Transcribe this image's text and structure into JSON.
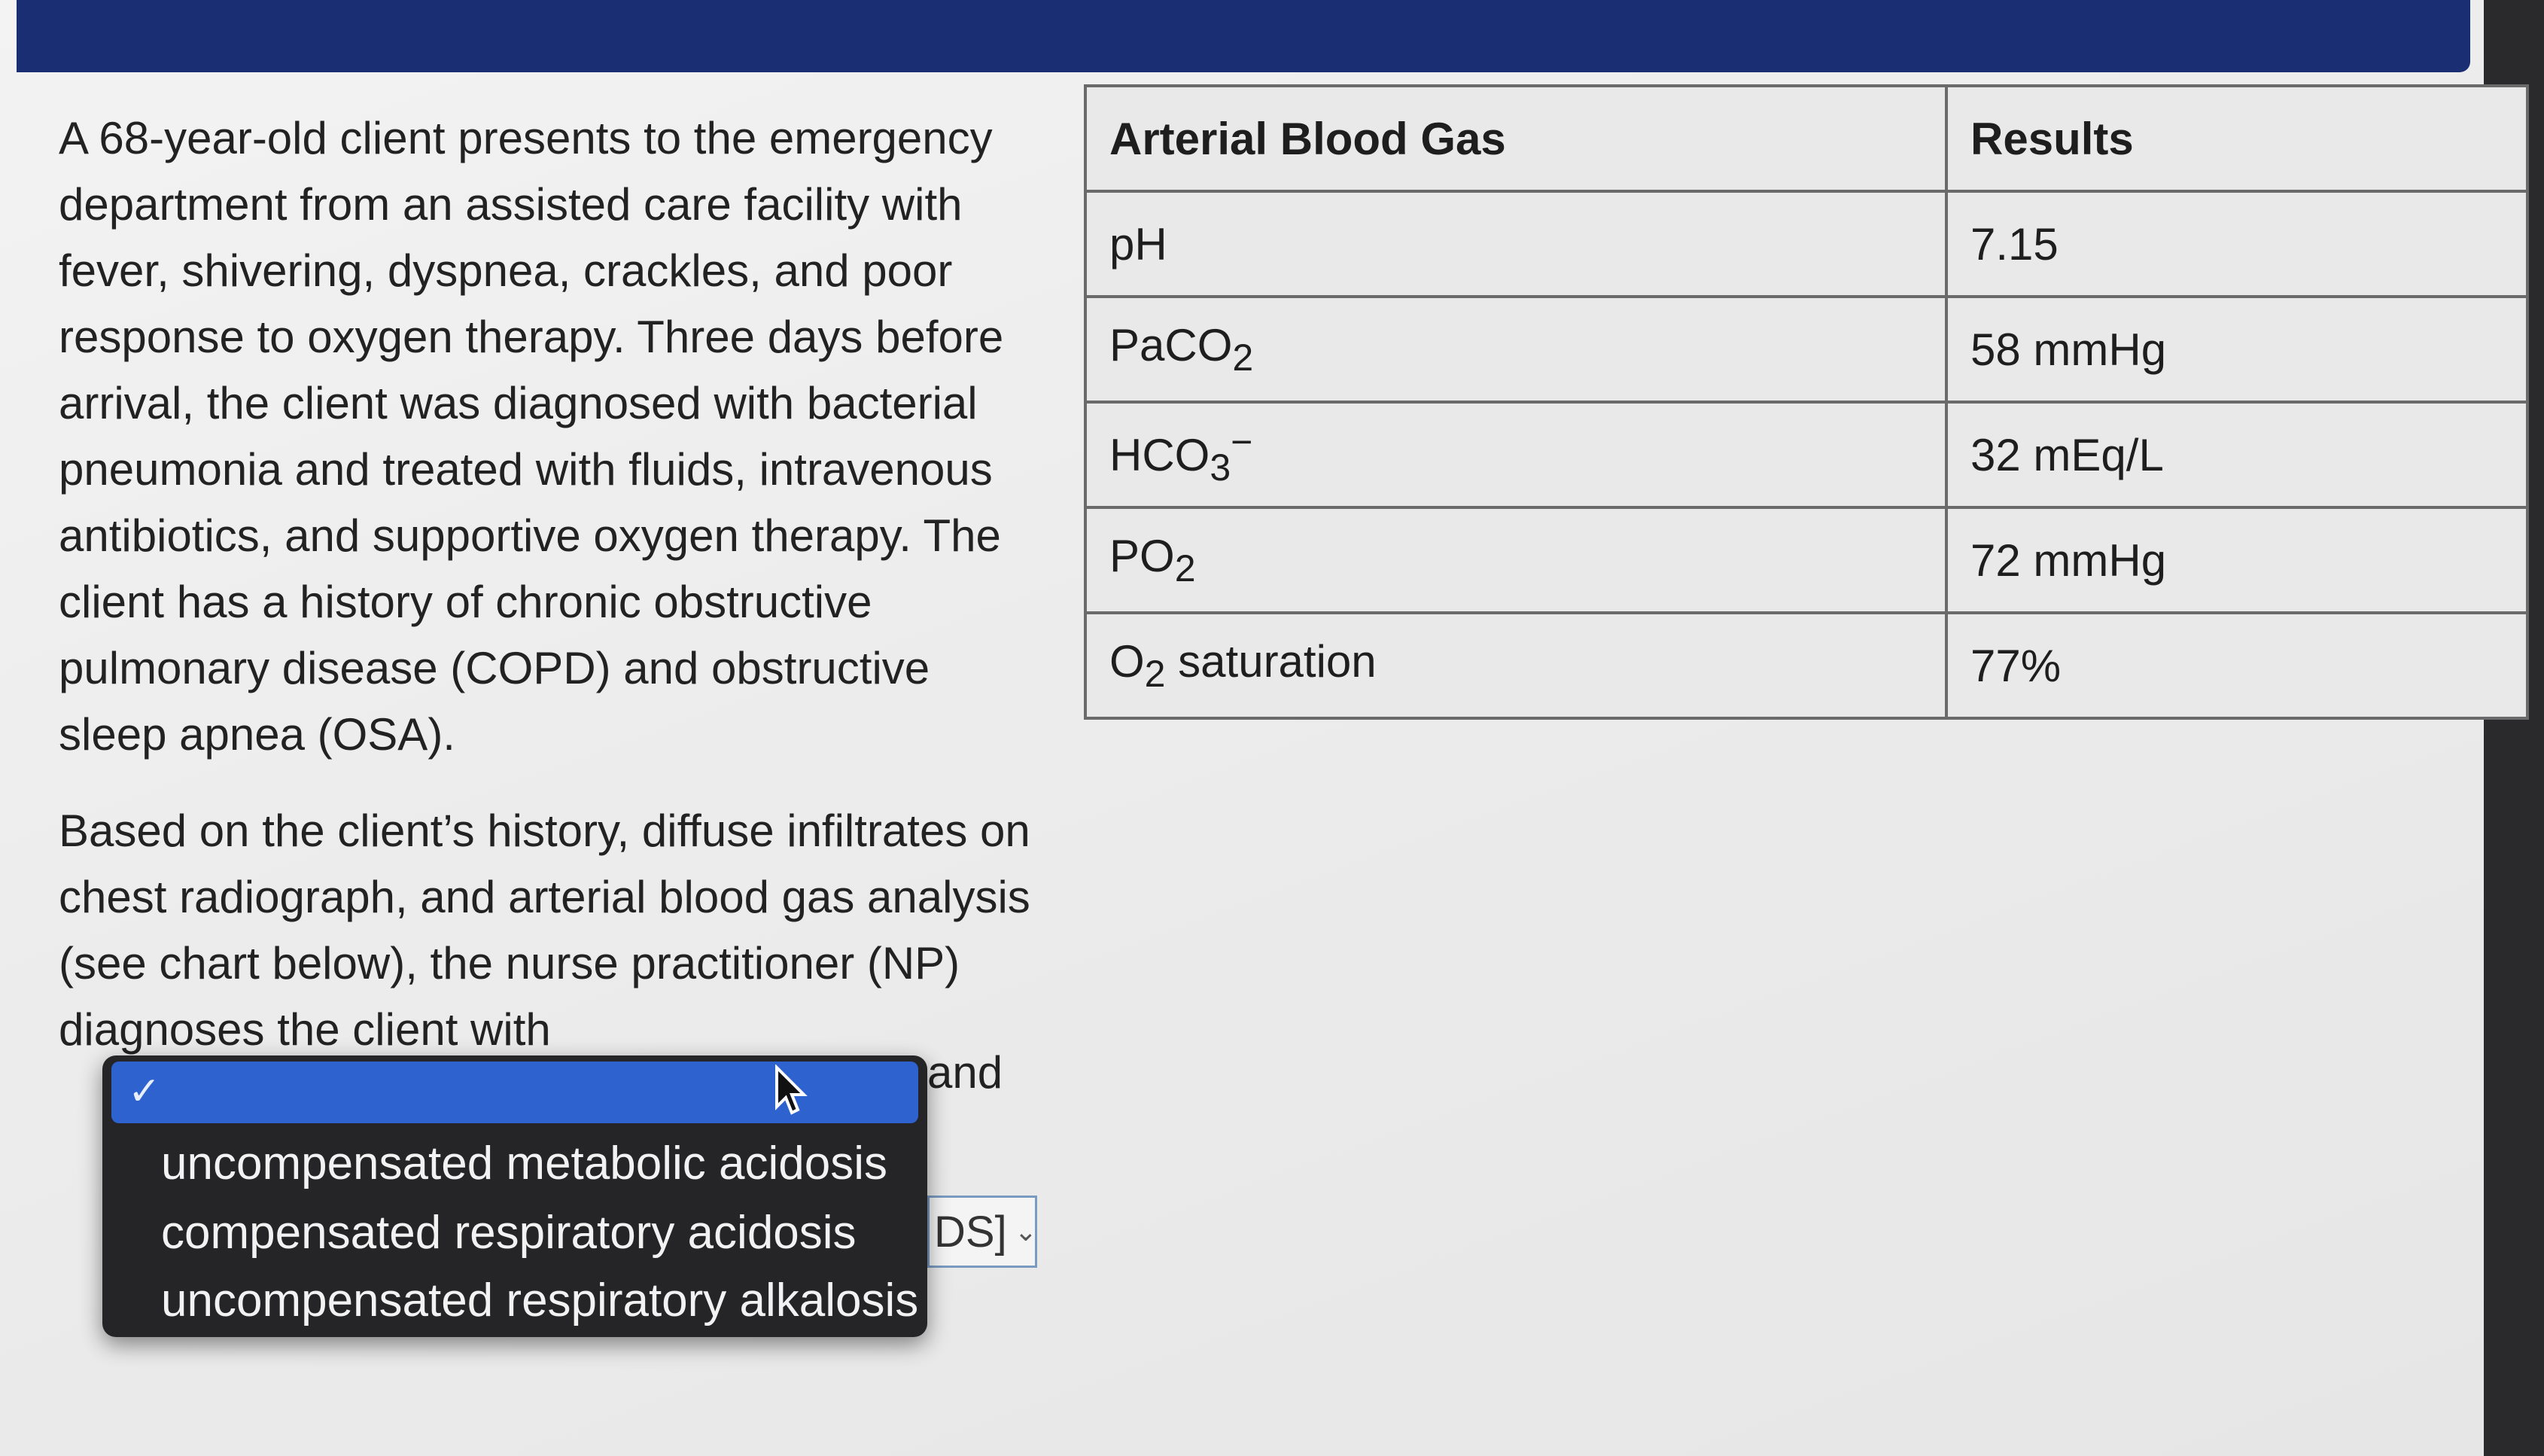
{
  "question": {
    "paragraph1": "A 68-year-old client presents to the emergency department from an assisted care facility with fever, shivering, dyspnea, crackles, and poor response to oxygen therapy. Three days before arrival, the client was diagnosed with bacterial pneumonia and treated with fluids, intravenous antibiotics, and supportive oxygen therapy. The client has a history of chronic obstructive pulmonary disease (COPD) and obstructive sleep apnea (OSA).",
    "paragraph2": "Based on the client’s history, diffuse infiltrates on chest radiograph, and arterial blood gas analysis (see chart below), the nurse practitioner (NP) diagnoses the client with",
    "connector": "and",
    "second_select_visible_text": "DS]"
  },
  "abg_table": {
    "header_test": "Arterial Blood Gas",
    "header_result": "Results",
    "rows": [
      {
        "test": "pH",
        "result": "7.15"
      },
      {
        "test": "PaCO",
        "test_sub": "2",
        "result": "58 mmHg"
      },
      {
        "test": "HCO",
        "test_sub": "3",
        "test_sup": "−",
        "result": "32 mEq/L"
      },
      {
        "test": "PO",
        "test_sub": "2",
        "result": "72 mmHg"
      },
      {
        "test": "O",
        "test_sub": "2",
        "test_suffix": " saturation",
        "result": "77%"
      }
    ]
  },
  "dropdown": {
    "selected_check": "✓",
    "options": [
      "uncompensated metabolic acidosis",
      "compensated respiratory acidosis",
      "uncompensated respiratory alkalosis"
    ]
  },
  "colors": {
    "banner": "#1a2e74",
    "dropdown_bg": "#252527",
    "dropdown_highlight": "#2e62cf"
  },
  "icons": {
    "select_chevron": "chevron-down-icon",
    "pointer": "mouse-pointer-icon"
  }
}
